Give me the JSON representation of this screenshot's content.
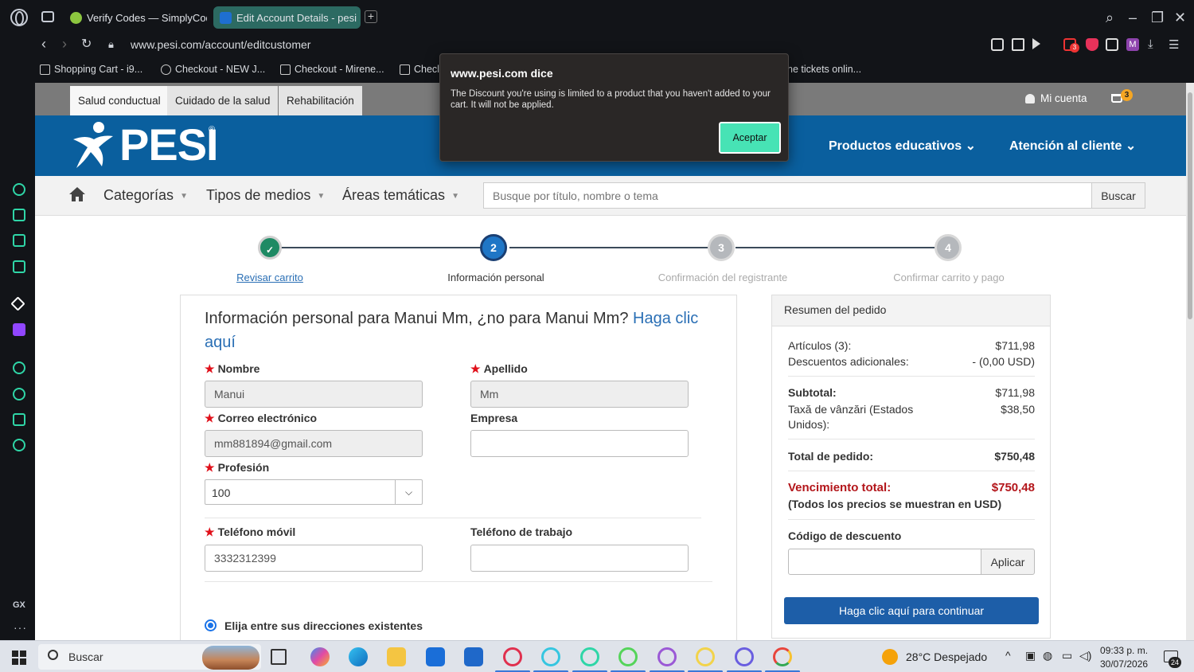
{
  "browser": {
    "tabs": [
      {
        "label": "Verify Codes — SimplyCod"
      },
      {
        "label": "Edit Account Details - pesi"
      }
    ],
    "url": "www.pesi.com/account/editcustomer",
    "bookmarks": [
      {
        "label": "Shopping Cart - i9..."
      },
      {
        "label": "Checkout - NEW J..."
      },
      {
        "label": "Checkout - Mirene..."
      },
      {
        "label": "Checl"
      },
      {
        "label": "ne tickets onlin..."
      }
    ],
    "extension_badge": "3",
    "sidebar_gx": "GX",
    "sidebar_more": "···"
  },
  "dialog": {
    "title": "www.pesi.com dice",
    "message": "The Discount you're using is limited to a product that you haven't added to your cart. It will not be applied.",
    "button": "Aceptar"
  },
  "site": {
    "top_categories": [
      "Salud conductual",
      "Cuidado de la salud",
      "Rehabilitación"
    ],
    "account_label": "Mi cuenta",
    "cart_count": "3",
    "logo_text": "PESI",
    "logo_reg": "®",
    "header_menu": [
      "Productos educativos",
      "Atención al cliente"
    ],
    "nav": [
      "Categorías",
      "Tipos de medios",
      "Áreas temáticas"
    ],
    "search_placeholder": "Busque por título, nombre o tema",
    "search_button": "Buscar"
  },
  "steps": [
    {
      "num": "✓",
      "label": "Revisar carrito",
      "state": "done"
    },
    {
      "num": "2",
      "label": "Información personal",
      "state": "active"
    },
    {
      "num": "3",
      "label": "Confirmación del registrante",
      "state": "pending"
    },
    {
      "num": "4",
      "label": "Confirmar carrito y pago",
      "state": "pending"
    }
  ],
  "form": {
    "heading": "Información personal para Manui Mm, ¿no para Manui Mm? ",
    "heading_link": "Haga clic aquí",
    "fields": {
      "nombre": {
        "label": "Nombre",
        "value": "Manui"
      },
      "apellido": {
        "label": "Apellido",
        "value": "Mm"
      },
      "correo": {
        "label": "Correo electrónico",
        "value": "mm881894@gmail.com"
      },
      "empresa": {
        "label": "Empresa",
        "value": ""
      },
      "profesion": {
        "label": "Profesión",
        "value": "100"
      },
      "movil": {
        "label": "Teléfono móvil",
        "value": "3332312399"
      },
      "trabajo": {
        "label": "Teléfono de trabajo",
        "value": ""
      }
    },
    "address_option": "Elija entre sus direcciones existentes"
  },
  "summary": {
    "title": "Resumen del pedido",
    "articulos_label": "Artículos (3):",
    "articulos_value": "$711,98",
    "descuentos_label": "Descuentos adicionales:",
    "descuentos_value": "- (0,00 USD)",
    "subtotal_label": "Subtotal:",
    "subtotal_value": "$711,98",
    "tax_label": "Taxă de vânzări (Estados Unidos):",
    "tax_value": "$38,50",
    "total_label": "Total de pedido:",
    "total_value": "$750,48",
    "due_label": "Vencimiento total:",
    "due_value": "$750,48",
    "usd_note": "(Todos los precios se muestran en USD)",
    "discount_label": "Código de descuento",
    "discount_button": "Aplicar",
    "continue_button": "Haga clic aquí para continuar"
  },
  "taskbar": {
    "search": "Buscar",
    "weather": "28°C  Despejado",
    "time": "09:33 p. m.",
    "date": "30/07/2026",
    "notif_count": "24"
  },
  "colors": {
    "brand_blue": "#0a5f9e",
    "step_done": "#1e8a64",
    "step_active": "#1f76c6",
    "step_pending": "#b5b8bc",
    "dialog_accent": "#47e3b5",
    "due_red": "#b3151a"
  }
}
